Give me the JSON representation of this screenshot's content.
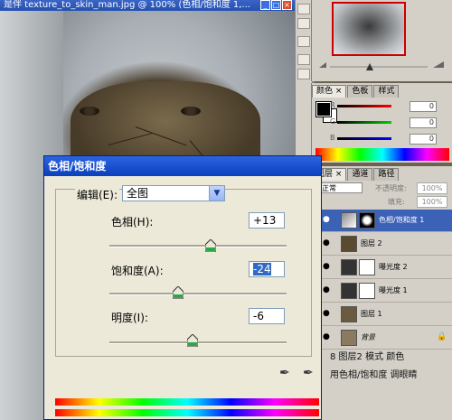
{
  "window": {
    "title": "是伴 texture_to_skin_man.jpg @ 100% (色相/饱和度 1,..."
  },
  "panels": {
    "color_tabs": [
      "颜色",
      "色板",
      "样式"
    ],
    "color_channels": [
      {
        "label": "R",
        "value": "0",
        "color": "#d00000"
      },
      {
        "label": "G",
        "value": "0",
        "color": "#00a000"
      },
      {
        "label": "B",
        "value": "0",
        "color": "#0000d0"
      }
    ],
    "layer_tabs": [
      "图层",
      "通道",
      "路径"
    ],
    "blend_mode": "正常",
    "opacity_label": "不透明度:",
    "opacity_value": "100%",
    "fill_label": "填充:",
    "fill_value": "100%",
    "layers": [
      {
        "name": "色相/饱和度 1",
        "selected": true
      },
      {
        "name": "图层 2",
        "selected": false
      },
      {
        "name": "曝光度 2",
        "selected": false
      },
      {
        "name": "曝光度 1",
        "selected": false
      },
      {
        "name": "图层 1",
        "selected": false
      },
      {
        "name": "背景",
        "selected": false
      }
    ]
  },
  "caption": {
    "line1": "8  图层2  模式  颜色",
    "line2": "用色相/饱和度  调眼睛"
  },
  "dialog": {
    "title": "色相/饱和度",
    "edit_label": "编辑(E):",
    "edit_value": "全图",
    "hue_label": "色相(H):",
    "hue_value": "+13",
    "saturation_label": "饱和度(A):",
    "saturation_value": "-24",
    "lightness_label": "明度(I):",
    "lightness_value": "-6"
  },
  "icons": [
    "eyedropper-icon",
    "eyedropper-plus-icon",
    "eye-icon",
    "lock-icon",
    "chevron-down-icon"
  ]
}
